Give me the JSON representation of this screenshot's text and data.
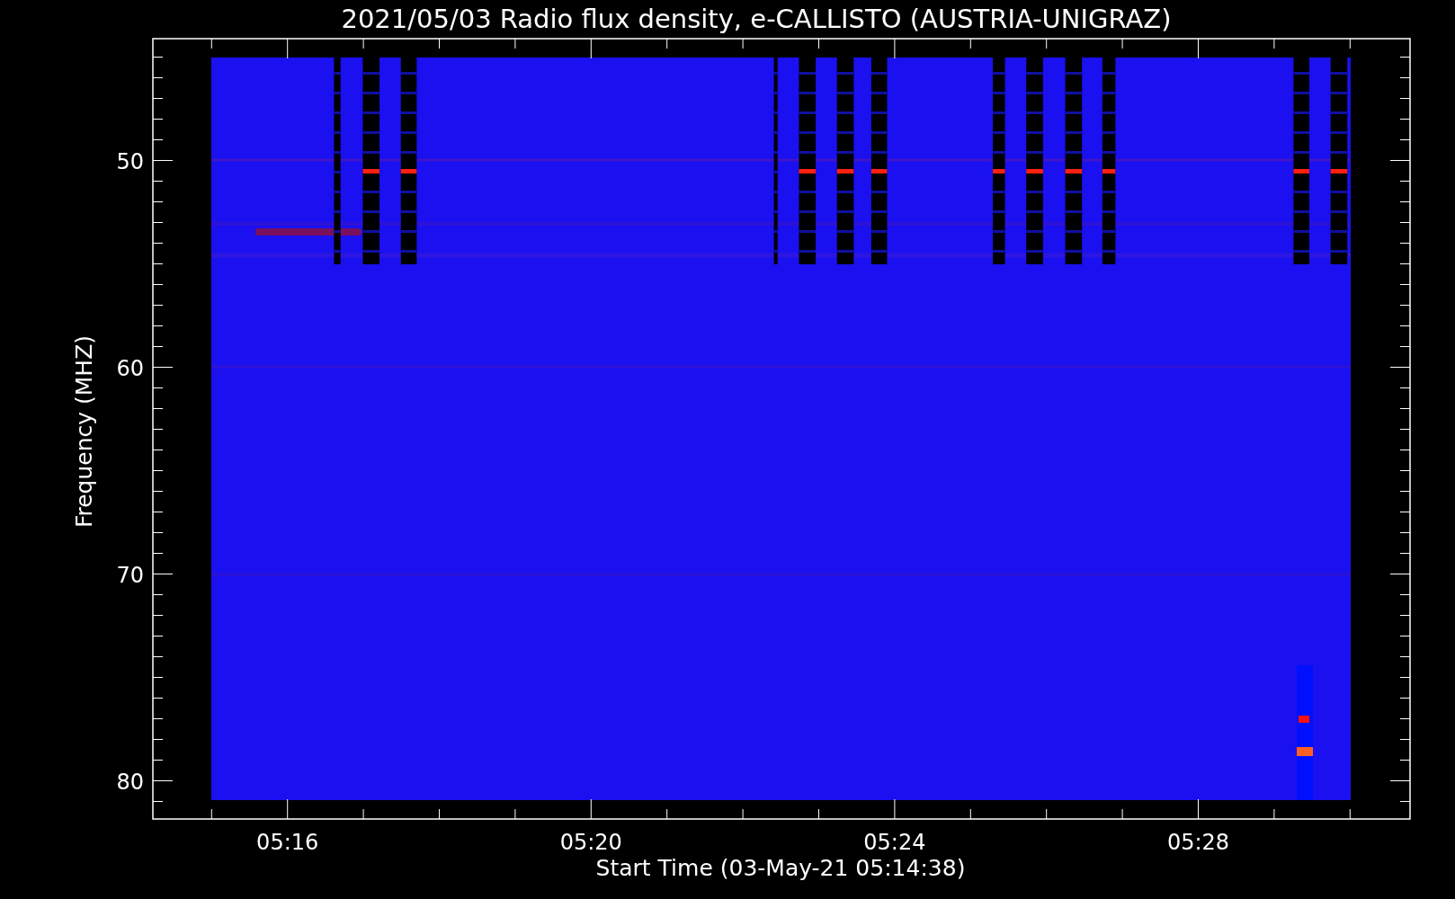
{
  "plot": {
    "title": "2021/05/03  Radio flux density, e-CALLISTO (AUSTRIA-UNIGRAZ)",
    "ylabel": "Frequency (MHZ)",
    "xlabel": "Start Time (03-May-21 05:14:38)",
    "y_tick_labels": [
      "50",
      "60",
      "70",
      "80"
    ],
    "x_tick_labels": [
      "05:16",
      "05:20",
      "05:24",
      "05:28"
    ]
  }
}
